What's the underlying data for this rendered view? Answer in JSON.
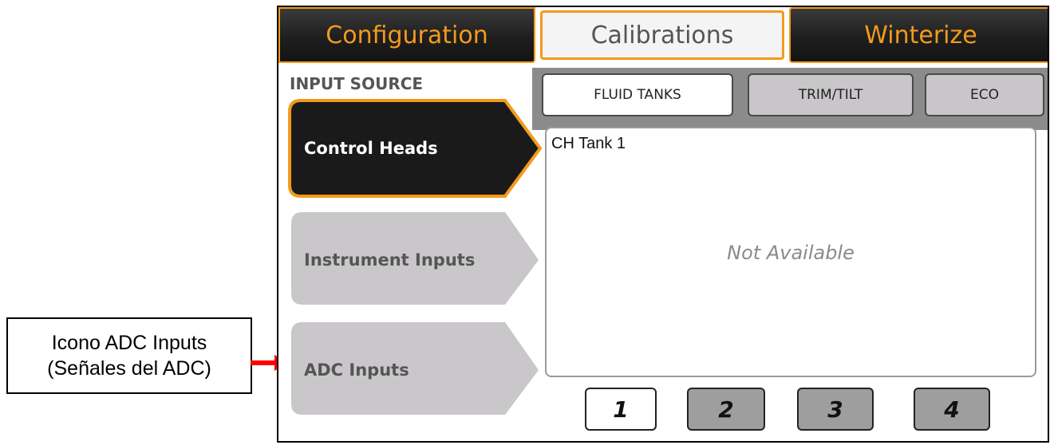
{
  "annotation": {
    "line1": "Icono ADC Inputs",
    "line2": "(Señales del ADC)",
    "arrow_color": "#ff0000"
  },
  "top_tabs": [
    {
      "label": "Configuration",
      "active": false
    },
    {
      "label": "Calibrations",
      "active": true
    },
    {
      "label": "Winterize",
      "active": false
    }
  ],
  "section_title": "INPUT SOURCE",
  "sub_tabs": [
    {
      "label": "FLUID TANKS",
      "active": true
    },
    {
      "label": "TRIM/TILT",
      "active": false
    },
    {
      "label": "ECO",
      "active": false
    }
  ],
  "sources": [
    {
      "label": "Control Heads",
      "selected": true
    },
    {
      "label": "Instrument Inputs",
      "selected": false
    },
    {
      "label": "ADC Inputs",
      "selected": false
    }
  ],
  "panel": {
    "title": "CH Tank 1",
    "status": "Not Available"
  },
  "pages": [
    {
      "label": "1",
      "active": true
    },
    {
      "label": "2",
      "active": false
    },
    {
      "label": "3",
      "active": false
    },
    {
      "label": "4",
      "active": false
    }
  ],
  "colors": {
    "accent": "#f39a1c",
    "dark": "#1a1a1a",
    "inactive": "#c9c7c9"
  }
}
